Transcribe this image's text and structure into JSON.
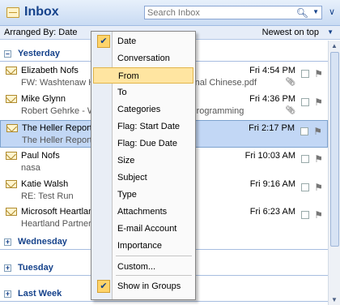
{
  "header": {
    "title": "Inbox",
    "search_placeholder": "Search Inbox"
  },
  "arrange": {
    "label": "Arranged By: Date",
    "sort": "Newest on top"
  },
  "groups": [
    {
      "label": "Yesterday",
      "expanded": true
    },
    {
      "label": "Wednesday",
      "expanded": false
    },
    {
      "label": "Tuesday",
      "expanded": false
    },
    {
      "label": "Last Week",
      "expanded": false
    }
  ],
  "messages": [
    {
      "sender": "Elizabeth Nofs",
      "subject": "FW: Washtenaw Heartland Partners Traditional Chinese.pdf",
      "time": "Fri 4:54 PM",
      "attachment": true
    },
    {
      "sender": "Mike Glynn",
      "subject": "Robert Gehrke - Washtenaw Electronics & Programming",
      "time": "Fri 4:36 PM",
      "attachment": true
    },
    {
      "sender": "The Heller Reports",
      "subject": "The Heller Reports - June 22, 2007",
      "time": "Fri 2:17 PM",
      "attachment": false,
      "selected": true
    },
    {
      "sender": "Paul Nofs",
      "subject": "nasa",
      "time": "Fri 10:03 AM",
      "attachment": false
    },
    {
      "sender": "Katie Walsh",
      "subject": "RE: Test Run",
      "time": "Fri 9:16 AM",
      "attachment": false
    },
    {
      "sender": "Microsoft Heartland",
      "subject": "Heartland Partners - March 2007",
      "time": "Fri 6:23 AM",
      "attachment": false
    }
  ],
  "menu": {
    "items": [
      {
        "label": "Date",
        "checked": true
      },
      {
        "label": "Conversation"
      },
      {
        "label": "From",
        "highlighted": true
      },
      {
        "label": "To"
      },
      {
        "label": "Categories"
      },
      {
        "label": "Flag: Start Date"
      },
      {
        "label": "Flag: Due Date"
      },
      {
        "label": "Size"
      },
      {
        "label": "Subject"
      },
      {
        "label": "Type"
      },
      {
        "label": "Attachments"
      },
      {
        "label": "E-mail Account"
      },
      {
        "label": "Importance"
      },
      {
        "label": "Custom..."
      },
      {
        "label": "Show in Groups",
        "checked": true
      }
    ]
  },
  "icons": {
    "check": "✔",
    "search": "search-icon",
    "flag": "flag-icon",
    "paperclip": "paperclip-icon"
  }
}
